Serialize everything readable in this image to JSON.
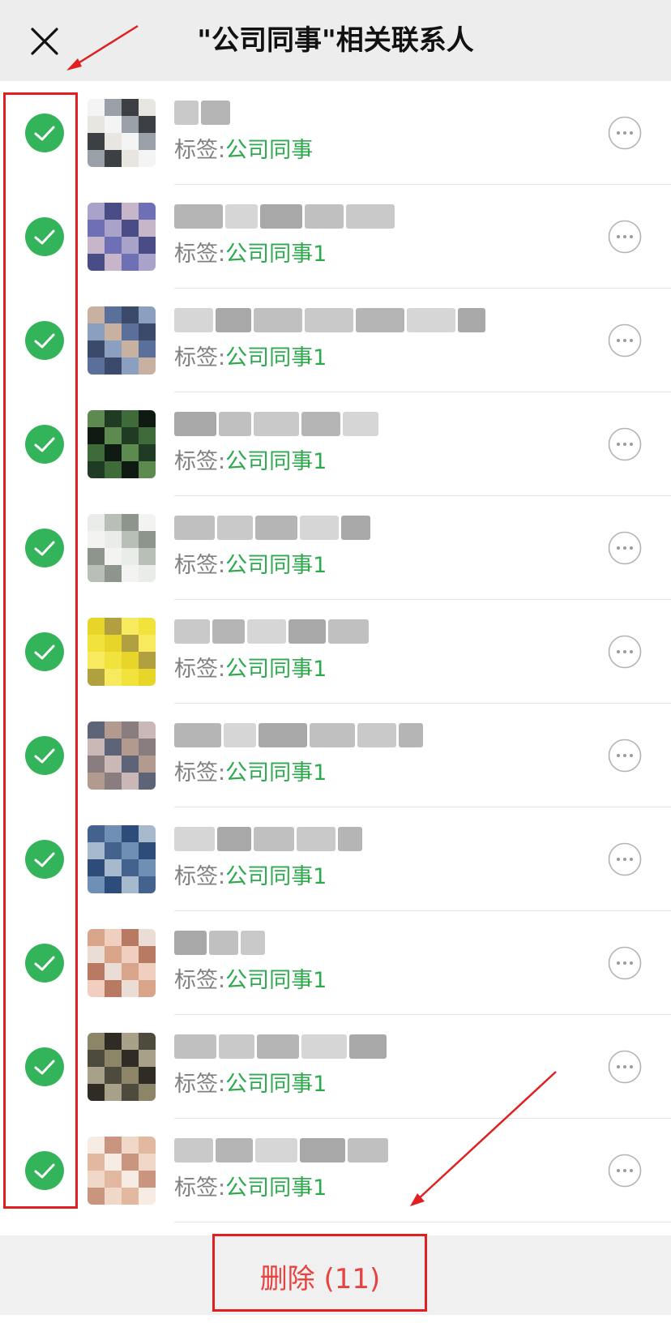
{
  "header": {
    "title": "\"公司同事\"相关联系人",
    "close_icon": "close-icon"
  },
  "contacts": [
    {
      "tag_label": "标签:",
      "tag_value": "公司同事",
      "selected": true,
      "avatar_colors": [
        "#f4f4f4",
        "#9aa0a8",
        "#3c3f44",
        "#e8e6e0"
      ]
    },
    {
      "tag_label": "标签:",
      "tag_value": "公司同事1",
      "selected": true,
      "avatar_colors": [
        "#6e6fb5",
        "#a9a3c9",
        "#4a4c86",
        "#c7b5c9"
      ]
    },
    {
      "tag_label": "标签:",
      "tag_value": "公司同事1",
      "selected": true,
      "avatar_colors": [
        "#3b4a6b",
        "#8ba0c0",
        "#c9b1a1",
        "#5a6f9a"
      ]
    },
    {
      "tag_label": "标签:",
      "tag_value": "公司同事1",
      "selected": true,
      "avatar_colors": [
        "#1f3b24",
        "#3f6b3a",
        "#0e1a12",
        "#5d8a4f"
      ]
    },
    {
      "tag_label": "标签:",
      "tag_value": "公司同事1",
      "selected": true,
      "avatar_colors": [
        "#e9ece8",
        "#b8bfb6",
        "#8e958c",
        "#f3f4f1"
      ]
    },
    {
      "tag_label": "标签:",
      "tag_value": "公司同事1",
      "selected": true,
      "avatar_colors": [
        "#f2e23c",
        "#e8d52a",
        "#b0a040",
        "#f7ea5e"
      ]
    },
    {
      "tag_label": "标签:",
      "tag_value": "公司同事1",
      "selected": true,
      "avatar_colors": [
        "#8a7d80",
        "#c9b8b5",
        "#5e6478",
        "#b39a8e"
      ]
    },
    {
      "tag_label": "标签:",
      "tag_value": "公司同事1",
      "selected": true,
      "avatar_colors": [
        "#6f8fb5",
        "#2d4c7a",
        "#a7b9cc",
        "#44628e"
      ]
    },
    {
      "tag_label": "标签:",
      "tag_value": "公司同事1",
      "selected": true,
      "avatar_colors": [
        "#d8a58a",
        "#f0cfc0",
        "#b97a63",
        "#e9ddd6"
      ]
    },
    {
      "tag_label": "标签:",
      "tag_value": "公司同事1",
      "selected": true,
      "avatar_colors": [
        "#4d4a3e",
        "#8d8568",
        "#2f2c26",
        "#a9a08a"
      ]
    },
    {
      "tag_label": "标签:",
      "tag_value": "公司同事1",
      "selected": true,
      "avatar_colors": [
        "#f0d8c8",
        "#e3b8a0",
        "#f7ece4",
        "#c9957e"
      ]
    }
  ],
  "footer": {
    "delete_label": "删除 (11)"
  },
  "colors": {
    "accent_green": "#2da94f",
    "check_green": "#34b45a",
    "delete_red": "#e64340",
    "annotation_red": "#e02020"
  }
}
